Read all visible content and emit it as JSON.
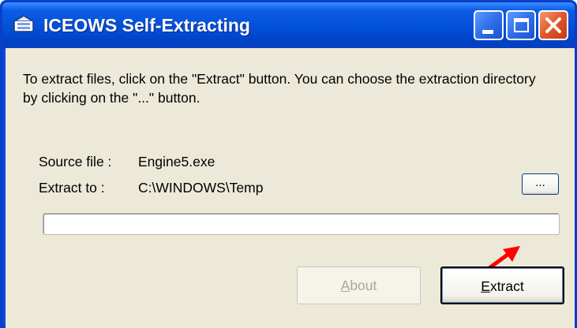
{
  "window": {
    "title": "ICEOWS Self-Extracting",
    "controls": {
      "minimize_icon": "minimize-icon",
      "maximize_icon": "maximize-icon",
      "close_icon": "close-icon"
    }
  },
  "message": "To extract files, click on the \"Extract\" button. You can choose the extraction directory by clicking on the \"...\" button.",
  "source": {
    "label": "Source file :",
    "value": "Engine5.exe"
  },
  "extract_to": {
    "label": "Extract to :",
    "value": "C:\\WINDOWS\\Temp"
  },
  "browse_button": {
    "label": "..."
  },
  "progress": {
    "value": 0
  },
  "buttons": {
    "about": {
      "first_letter": "A",
      "rest": "bout",
      "enabled": false
    },
    "extract": {
      "first_letter": "E",
      "rest": "xtract",
      "enabled": true
    }
  },
  "colors": {
    "titlebar": "#0350d6",
    "client_bg": "#ece9d8",
    "annotation_arrow": "#ff0000"
  }
}
